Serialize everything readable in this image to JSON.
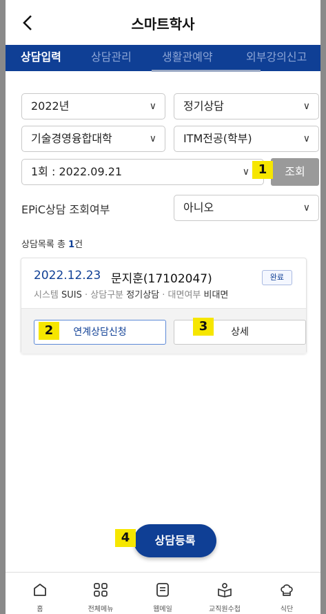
{
  "header": {
    "title": "스마트학사",
    "back_icon": "chevron-left-icon"
  },
  "tabs": [
    {
      "label": "상담입력",
      "active": true
    },
    {
      "label": "상담관리",
      "active": false
    },
    {
      "label": "생활관예약",
      "active": false
    },
    {
      "label": "외부강의신고",
      "active": false
    }
  ],
  "filters": {
    "year": "2022년",
    "consult_type": "정기상담",
    "college": "기술경영융합대학",
    "department": "ITM전공(학부)",
    "session": "1회 : 2022.09.21",
    "search_button": "조회",
    "epic_label": "EPiC상담 조회여부",
    "epic_value": "아니오"
  },
  "list_count": {
    "prefix": "상담목록 총 ",
    "count": "1",
    "suffix": "건"
  },
  "card": {
    "date": "2022.12.23",
    "name": "문지훈(17102047)",
    "status": "완료",
    "system_label": "시스템",
    "system_value": "SUIS",
    "type_label": "상담구분",
    "type_value": "정기상담",
    "mode_label": "대면여부",
    "mode_value": "비대면",
    "link_button": "연계상담신청",
    "detail_button": "상세"
  },
  "fab_label": "상담등록",
  "markers": [
    "1",
    "2",
    "3",
    "4"
  ],
  "bottom_nav": [
    {
      "label": "홈",
      "icon": "home-icon"
    },
    {
      "label": "전체메뉴",
      "icon": "grid-menu-icon"
    },
    {
      "label": "웹메일",
      "icon": "mail-icon"
    },
    {
      "label": "교직원수첩",
      "icon": "staff-book-icon"
    },
    {
      "label": "식단",
      "icon": "chef-hat-icon"
    }
  ],
  "colors": {
    "primary": "#0f3f95",
    "marker": "#f6e600",
    "search_button": "#9a9a9a"
  }
}
